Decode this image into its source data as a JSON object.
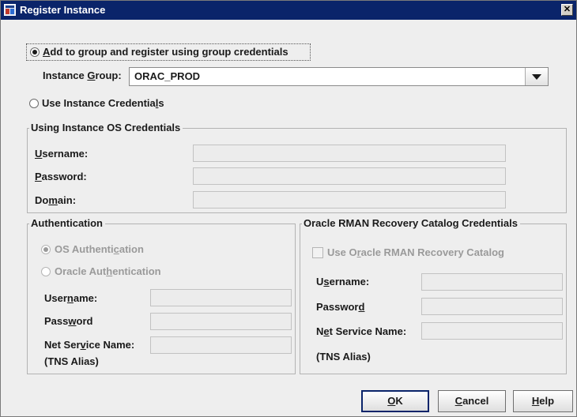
{
  "window": {
    "title": "Register Instance",
    "close_glyph": "✕"
  },
  "group_option": {
    "label_pre": "",
    "label_mn": "A",
    "label_post": "dd to group and register using group credentials",
    "instance_group": {
      "label_pre": "Instance ",
      "label_mn": "G",
      "label_post": "roup:",
      "value": "ORAC_PROD"
    }
  },
  "instance_option": {
    "label_pre": "Use Instance Credentia",
    "label_mn": "l",
    "label_post": "s"
  },
  "os_credentials": {
    "legend": "Using Instance OS Credentials",
    "username": {
      "pre": "",
      "mn": "U",
      "post": "sername:"
    },
    "password": {
      "pre": "",
      "mn": "P",
      "post": "assword:"
    },
    "domain": {
      "pre": "Do",
      "mn": "m",
      "post": "ain:"
    }
  },
  "authentication": {
    "legend": "Authentication",
    "os_auth": {
      "pre": "OS Authenti",
      "mn": "c",
      "post": "ation"
    },
    "oracle_auth": {
      "pre": "Oracle Aut",
      "mn": "h",
      "post": "entication"
    },
    "username": {
      "pre": "User",
      "mn": "n",
      "post": "ame:"
    },
    "password": {
      "pre": "Pass",
      "mn": "w",
      "post": "ord"
    },
    "net_service": {
      "pre": "Net Ser",
      "mn": "v",
      "post": "ice Name:"
    },
    "tns_alias": "(TNS Alias)"
  },
  "rman": {
    "legend": "Oracle RMAN Recovery Catalog Credentials",
    "use_catalog": {
      "pre": "Use O",
      "mn": "r",
      "post": "acle RMAN Recovery Catalog"
    },
    "username": {
      "pre": "U",
      "mn": "s",
      "post": "ername:"
    },
    "password": {
      "pre": "Passwor",
      "mn": "d",
      "post": ""
    },
    "net_service": {
      "pre": "N",
      "mn": "e",
      "post": "t Service Name:"
    },
    "tns_alias": "(TNS Alias)"
  },
  "buttons": {
    "ok": {
      "pre": "",
      "mn": "O",
      "post": "K"
    },
    "cancel": {
      "pre": "",
      "mn": "C",
      "post": "ancel"
    },
    "help": {
      "pre": "",
      "mn": "H",
      "post": "elp"
    }
  },
  "icons": {
    "window_icon": "app-window-icon",
    "close": "close-icon",
    "dropdown": "chevron-down-icon"
  }
}
